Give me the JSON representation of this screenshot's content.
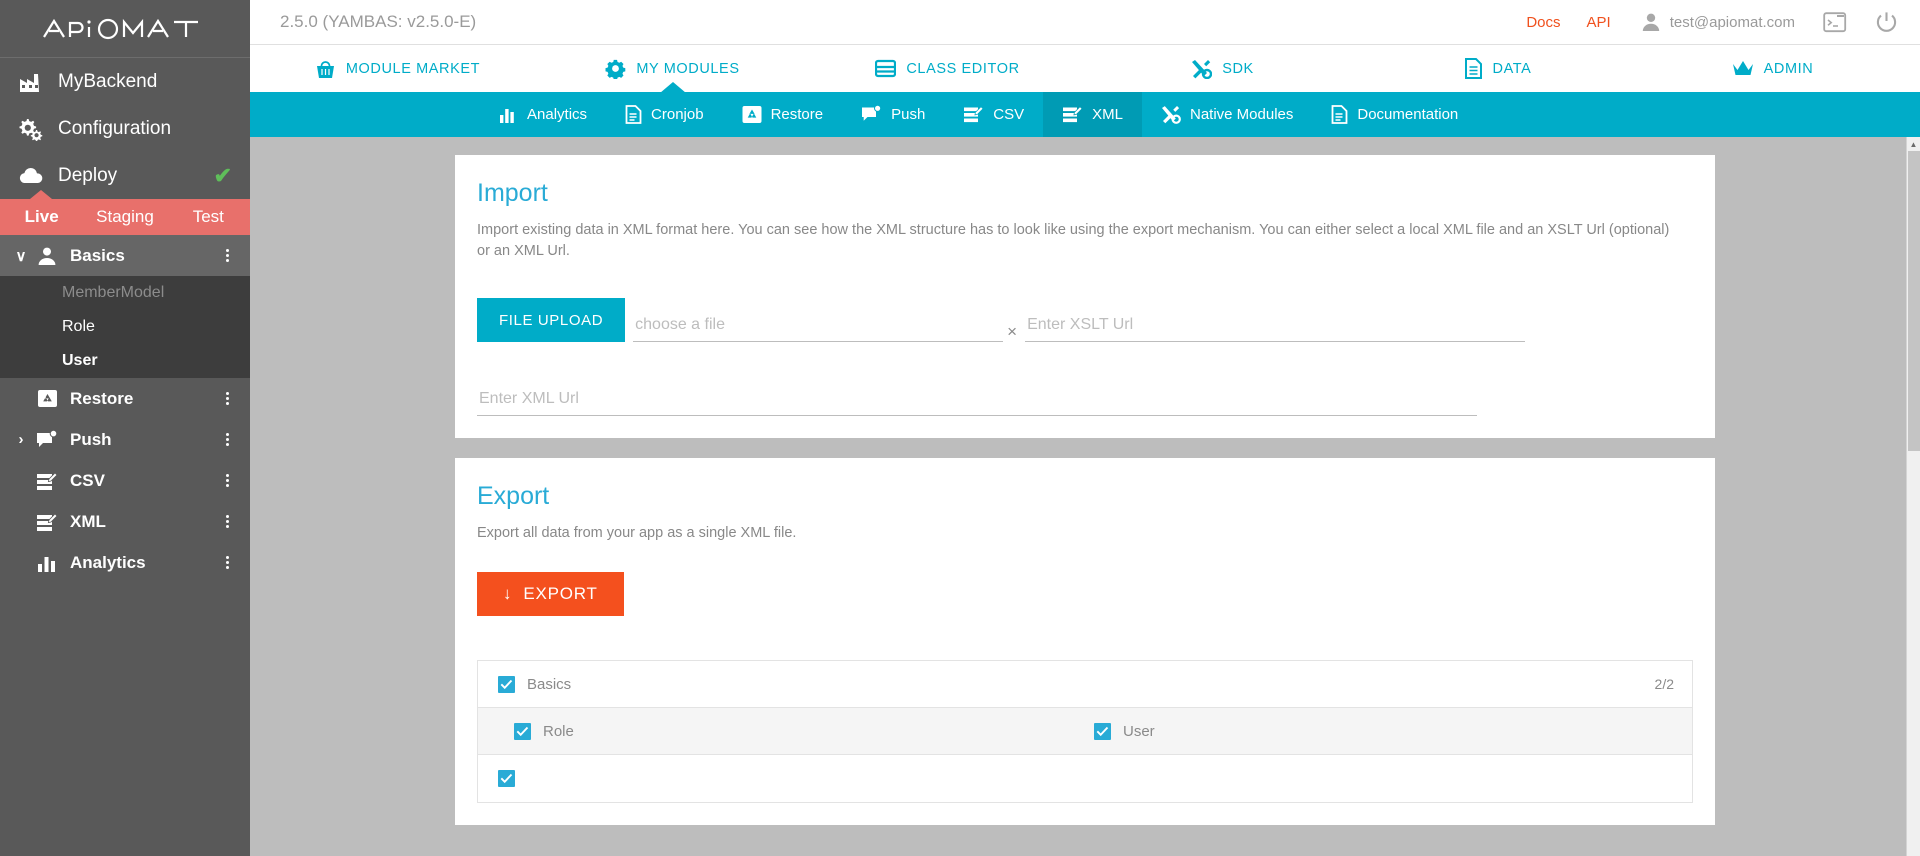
{
  "brand": {
    "logo_text": "APiOMAT",
    "accent_teal": "#00ACC8",
    "accent_orange": "#F0511E",
    "env_red": "#E8706B",
    "sidebar_gray": "#595959",
    "content_gray": "#BDBDBD"
  },
  "sidebar": {
    "primary_items": [
      {
        "label": "MyBackend",
        "icon": "factory-icon"
      },
      {
        "label": "Configuration",
        "icon": "gears-icon"
      },
      {
        "label": "Deploy",
        "icon": "cloud-icon",
        "status": "✔"
      }
    ],
    "environments": [
      {
        "label": "Live",
        "active": true
      },
      {
        "label": "Staging",
        "active": false
      },
      {
        "label": "Test",
        "active": false
      }
    ],
    "modules": [
      {
        "label": "Basics",
        "icon": "person-icon",
        "expanded": true,
        "chevron": "∨",
        "children": [
          {
            "label": "MemberModel",
            "state": "disabled"
          },
          {
            "label": "Role",
            "state": "normal"
          },
          {
            "label": "User",
            "state": "selected"
          }
        ]
      },
      {
        "label": "Restore",
        "icon": "restore-icon",
        "expanded": false,
        "chevron": ""
      },
      {
        "label": "Push",
        "icon": "push-icon",
        "expanded": false,
        "chevron": "›"
      },
      {
        "label": "CSV",
        "icon": "csv-icon",
        "expanded": false,
        "chevron": ""
      },
      {
        "label": "XML",
        "icon": "xml-icon",
        "expanded": false,
        "chevron": ""
      },
      {
        "label": "Analytics",
        "icon": "analytics-icon",
        "expanded": false,
        "chevron": ""
      }
    ]
  },
  "topbar": {
    "version": "2.5.0 (YAMBAS: v2.5.0-E)",
    "docs_label": "Docs",
    "api_label": "API",
    "user_email": "test@apiomat.com",
    "terminal_icon": "terminal-icon",
    "power_icon": "power-icon"
  },
  "mainnav": [
    {
      "label": "MODULE MARKET",
      "icon": "basket-icon",
      "active": false
    },
    {
      "label": "MY MODULES",
      "icon": "gear-icon",
      "active": true
    },
    {
      "label": "CLASS EDITOR",
      "icon": "table-icon",
      "active": false
    },
    {
      "label": "SDK",
      "icon": "tools-icon",
      "active": false
    },
    {
      "label": "DATA",
      "icon": "document-icon",
      "active": false
    },
    {
      "label": "ADMIN",
      "icon": "crown-icon",
      "active": false
    }
  ],
  "subnav": [
    {
      "label": "Analytics",
      "icon": "analytics-icon",
      "active": false
    },
    {
      "label": "Cronjob",
      "icon": "cronjob-icon",
      "active": false
    },
    {
      "label": "Restore",
      "icon": "restore-icon",
      "active": false
    },
    {
      "label": "Push",
      "icon": "push-icon",
      "active": false
    },
    {
      "label": "CSV",
      "icon": "csv-icon",
      "active": false
    },
    {
      "label": "XML",
      "icon": "xml-icon",
      "active": true
    },
    {
      "label": "Native Modules",
      "icon": "native-modules-icon",
      "active": false
    },
    {
      "label": "Documentation",
      "icon": "documentation-icon",
      "active": false
    }
  ],
  "import_card": {
    "title": "Import",
    "description": "Import existing data in XML format here. You can see how the XML structure has to look like using the export mechanism. You can either select a local XML file and an XSLT Url (optional) or an XML Url.",
    "upload_button": "FILE UPLOAD",
    "file_placeholder": "choose a file",
    "file_value": "",
    "clear_icon": "×",
    "xslt_placeholder": "Enter XSLT Url",
    "xslt_value": "",
    "xmlurl_placeholder": "Enter XML Url",
    "xmlurl_value": ""
  },
  "export_card": {
    "title": "Export",
    "description": "Export all data from your app as a single XML file.",
    "export_button": "EXPORT",
    "export_arrow": "↓",
    "tree": [
      {
        "label": "Basics",
        "checked": true,
        "count": "2/2",
        "level": 0,
        "children": [
          {
            "label": "Role",
            "checked": true
          },
          {
            "label": "User",
            "checked": true
          }
        ]
      },
      {
        "label": "",
        "checked": true,
        "count": "",
        "level": 0,
        "children": []
      }
    ]
  },
  "scrollbar": {
    "up_arrow": "▲",
    "down_arrow": "▼"
  }
}
